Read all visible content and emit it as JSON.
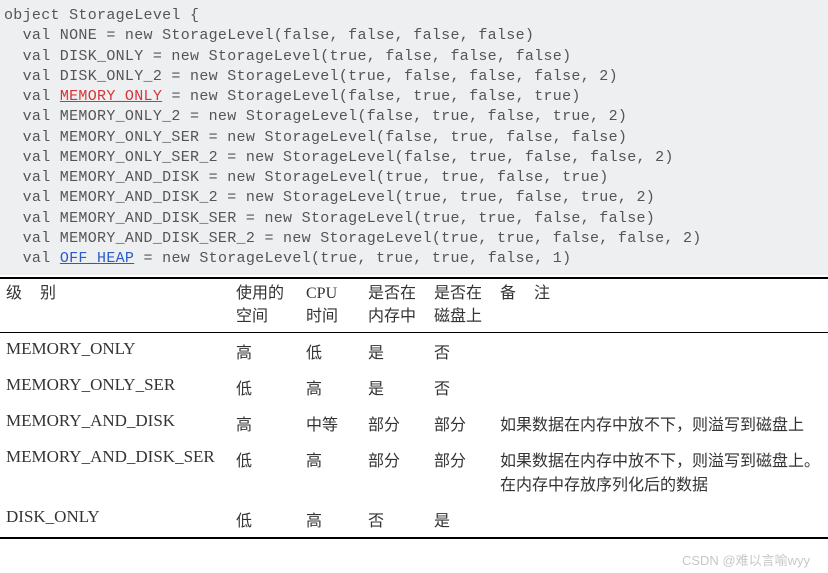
{
  "code": {
    "lines": [
      {
        "pre": "object StorageLevel {",
        "hl": "",
        "hlClass": "",
        "post": ""
      },
      {
        "pre": "  val NONE = new StorageLevel(false, false, false, false)",
        "hl": "",
        "hlClass": "",
        "post": ""
      },
      {
        "pre": "  val DISK_ONLY = new StorageLevel(true, false, false, false)",
        "hl": "",
        "hlClass": "",
        "post": ""
      },
      {
        "pre": "  val DISK_ONLY_2 = new StorageLevel(true, false, false, false, 2)",
        "hl": "",
        "hlClass": "",
        "post": ""
      },
      {
        "pre": "  val ",
        "hl": "MEMORY_ONLY",
        "hlClass": "hl-red",
        "post": " = new StorageLevel(false, true, false, true)"
      },
      {
        "pre": "  val MEMORY_ONLY_2 = new StorageLevel(false, true, false, true, 2)",
        "hl": "",
        "hlClass": "",
        "post": ""
      },
      {
        "pre": "  val MEMORY_ONLY_SER = new StorageLevel(false, true, false, false)",
        "hl": "",
        "hlClass": "",
        "post": ""
      },
      {
        "pre": "  val MEMORY_ONLY_SER_2 = new StorageLevel(false, true, false, false, 2)",
        "hl": "",
        "hlClass": "",
        "post": ""
      },
      {
        "pre": "  val MEMORY_AND_DISK = new StorageLevel(true, true, false, true)",
        "hl": "",
        "hlClass": "",
        "post": ""
      },
      {
        "pre": "  val MEMORY_AND_DISK_2 = new StorageLevel(true, true, false, true, 2)",
        "hl": "",
        "hlClass": "",
        "post": ""
      },
      {
        "pre": "  val MEMORY_AND_DISK_SER = new StorageLevel(true, true, false, false)",
        "hl": "",
        "hlClass": "",
        "post": ""
      },
      {
        "pre": "  val MEMORY_AND_DISK_SER_2 = new StorageLevel(true, true, false, false, 2)",
        "hl": "",
        "hlClass": "",
        "post": ""
      },
      {
        "pre": "  val ",
        "hl": "OFF_HEAP",
        "hlClass": "hl-blue",
        "post": " = new StorageLevel(true, true, true, false, 1)"
      }
    ]
  },
  "table": {
    "headers": {
      "level": "级别",
      "space1": "使用的",
      "space2": "空间",
      "cpu1": "CPU",
      "cpu2": "时间",
      "mem1": "是否在",
      "mem2": "内存中",
      "disk1": "是否在",
      "disk2": "磁盘上",
      "note": "备注"
    },
    "rows": [
      {
        "level": "MEMORY_ONLY",
        "space": "高",
        "cpu": "低",
        "mem": "是",
        "disk": "否",
        "note": ""
      },
      {
        "level": "MEMORY_ONLY_SER",
        "space": "低",
        "cpu": "高",
        "mem": "是",
        "disk": "否",
        "note": ""
      },
      {
        "level": "MEMORY_AND_DISK",
        "space": "高",
        "cpu": "中等",
        "mem": "部分",
        "disk": "部分",
        "note": "如果数据在内存中放不下，则溢写到磁盘上"
      },
      {
        "level": "MEMORY_AND_DISK_SER",
        "space": "低",
        "cpu": "高",
        "mem": "部分",
        "disk": "部分",
        "note": "如果数据在内存中放不下，则溢写到磁盘上。在内存中存放序列化后的数据"
      },
      {
        "level": "DISK_ONLY",
        "space": "低",
        "cpu": "高",
        "mem": "否",
        "disk": "是",
        "note": ""
      }
    ]
  },
  "watermark": "CSDN @难以言喻wyy"
}
